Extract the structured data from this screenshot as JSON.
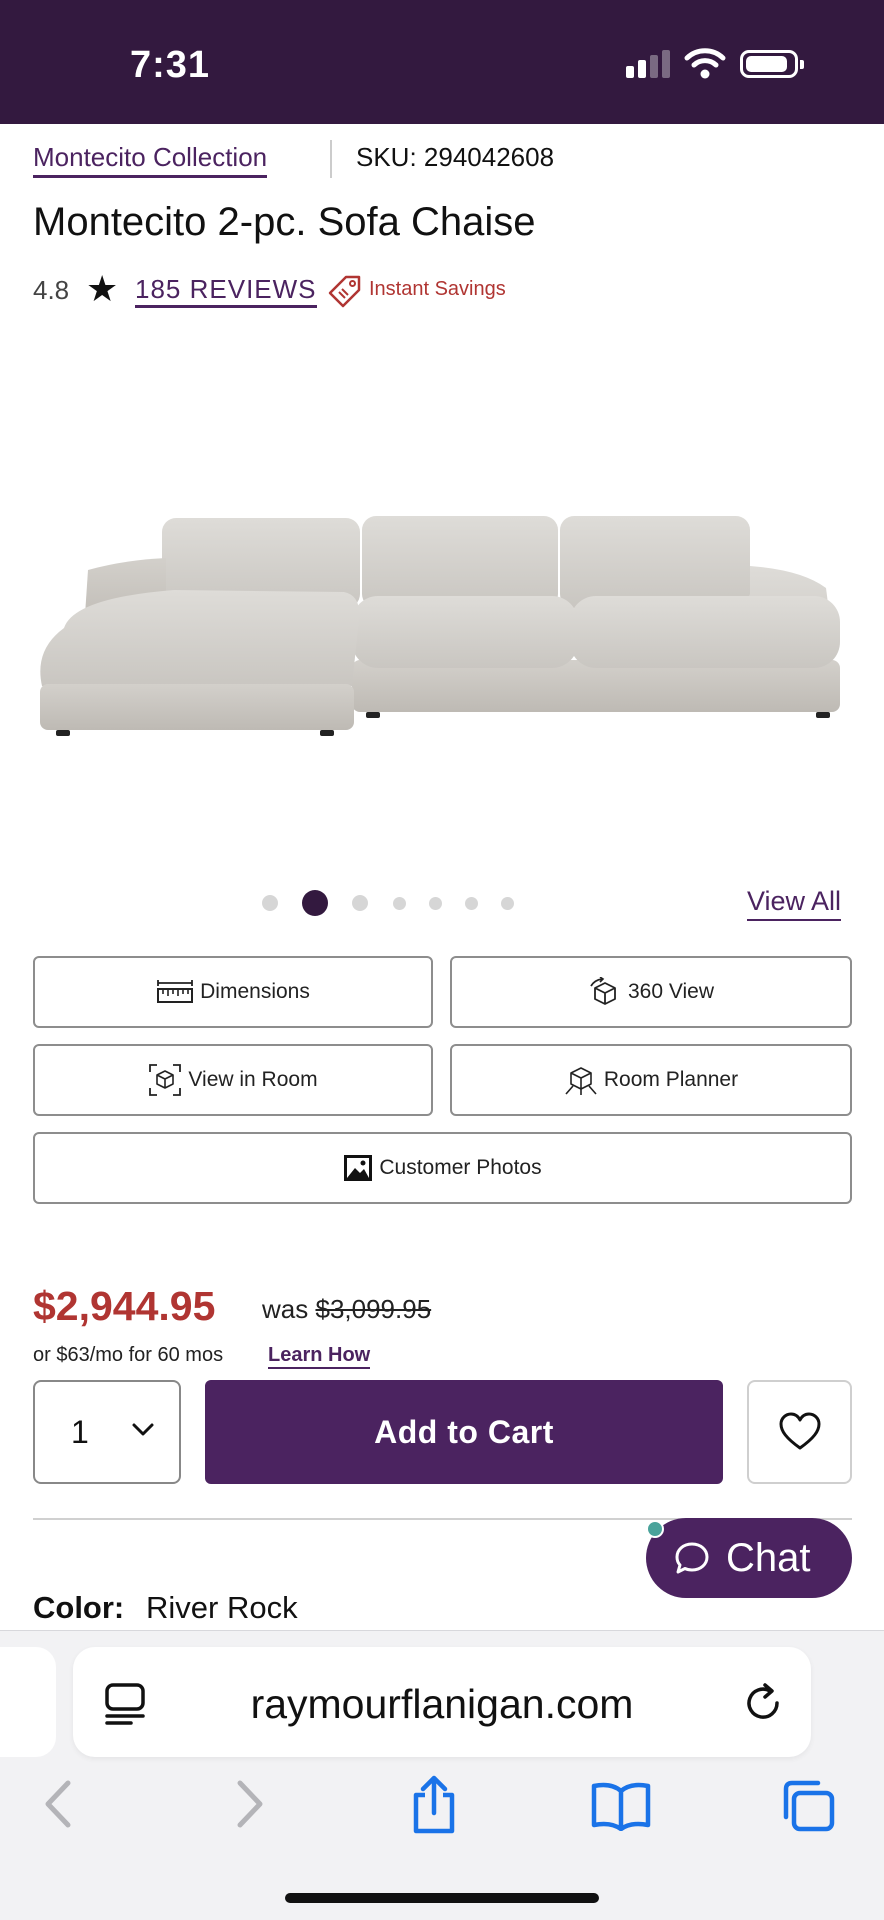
{
  "status_bar": {
    "time": "7:31",
    "signal_bars": 2,
    "battery_level": 0.8
  },
  "product": {
    "collection": "Montecito Collection",
    "sku": "SKU: 294042608",
    "title": "Montecito 2-pc. Sofa Chaise",
    "rating": "4.8",
    "reviews": "185 REVIEWS",
    "promo": "Instant Savings"
  },
  "gallery": {
    "dot_count": 7,
    "active_index": 1,
    "view_all": "View All"
  },
  "media_buttons": {
    "dimensions": "Dimensions",
    "view_360": "360 View",
    "view_in_room": "View in Room",
    "room_planner": "Room Planner",
    "customer_photos": "Customer Photos"
  },
  "pricing": {
    "price": "$2,944.95",
    "was_label": "was",
    "was_price": "$3,099.95",
    "financing": "or $63/mo for 60 mos",
    "learn_how": "Learn How"
  },
  "cart": {
    "quantity": "1",
    "add_to_cart": "Add to Cart"
  },
  "chat": {
    "label": "Chat"
  },
  "color": {
    "label": "Color:",
    "value": "River Rock"
  },
  "browser": {
    "url": "raymourflanigan.com"
  },
  "colors": {
    "brand": "#4b2360",
    "status_bar": "#33193f",
    "sale": "#b03532",
    "ios_blue": "#1a73e8"
  }
}
